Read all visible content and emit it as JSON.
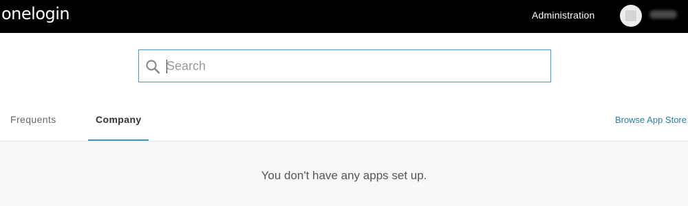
{
  "topbar": {
    "logo_text": "onelogin",
    "admin_label": "Administration",
    "user_name": ""
  },
  "search": {
    "placeholder": "Search",
    "value": ""
  },
  "tabs": [
    {
      "label": "Frequents",
      "active": false
    },
    {
      "label": "Company",
      "active": true
    }
  ],
  "browse_label": "Browse App Store",
  "empty_message": "You don't have any apps set up.",
  "colors": {
    "topbar": "#000000",
    "accent": "#3d9cc4",
    "link": "#2a7ca3",
    "content_bg": "#f7f8f9"
  },
  "icons": {
    "search": "search-icon",
    "avatar": "avatar"
  }
}
